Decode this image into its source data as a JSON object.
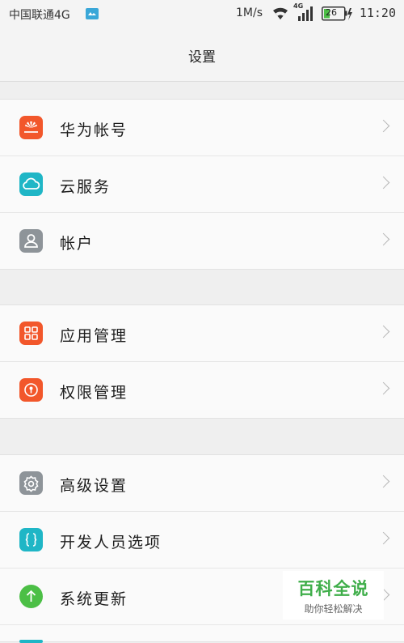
{
  "status_bar": {
    "carrier": "中国联通4G",
    "speed": "1M/s",
    "signal_label": "4G",
    "battery": "26",
    "time": "11:20"
  },
  "header": {
    "title": "设置"
  },
  "groups": [
    {
      "items": [
        {
          "label": "华为帐号",
          "icon": "huawei-logo-icon",
          "color": "#f2572b"
        },
        {
          "label": "云服务",
          "icon": "cloud-icon",
          "color": "#1fb6c6"
        },
        {
          "label": "帐户",
          "icon": "person-icon",
          "color": "#8e9499"
        }
      ]
    },
    {
      "items": [
        {
          "label": "应用管理",
          "icon": "app-grid-icon",
          "color": "#f2572b"
        },
        {
          "label": "权限管理",
          "icon": "key-lock-icon",
          "color": "#f2572b"
        }
      ]
    },
    {
      "items": [
        {
          "label": "高级设置",
          "icon": "gear-icon",
          "color": "#8e9499"
        },
        {
          "label": "开发人员选项",
          "icon": "braces-icon",
          "color": "#1fb6c6"
        },
        {
          "label": "系统更新",
          "icon": "arrow-up-icon",
          "color": "#4cbf46"
        }
      ]
    }
  ],
  "watermark": {
    "title": "百科全说",
    "subtitle": "助你轻松解决"
  }
}
